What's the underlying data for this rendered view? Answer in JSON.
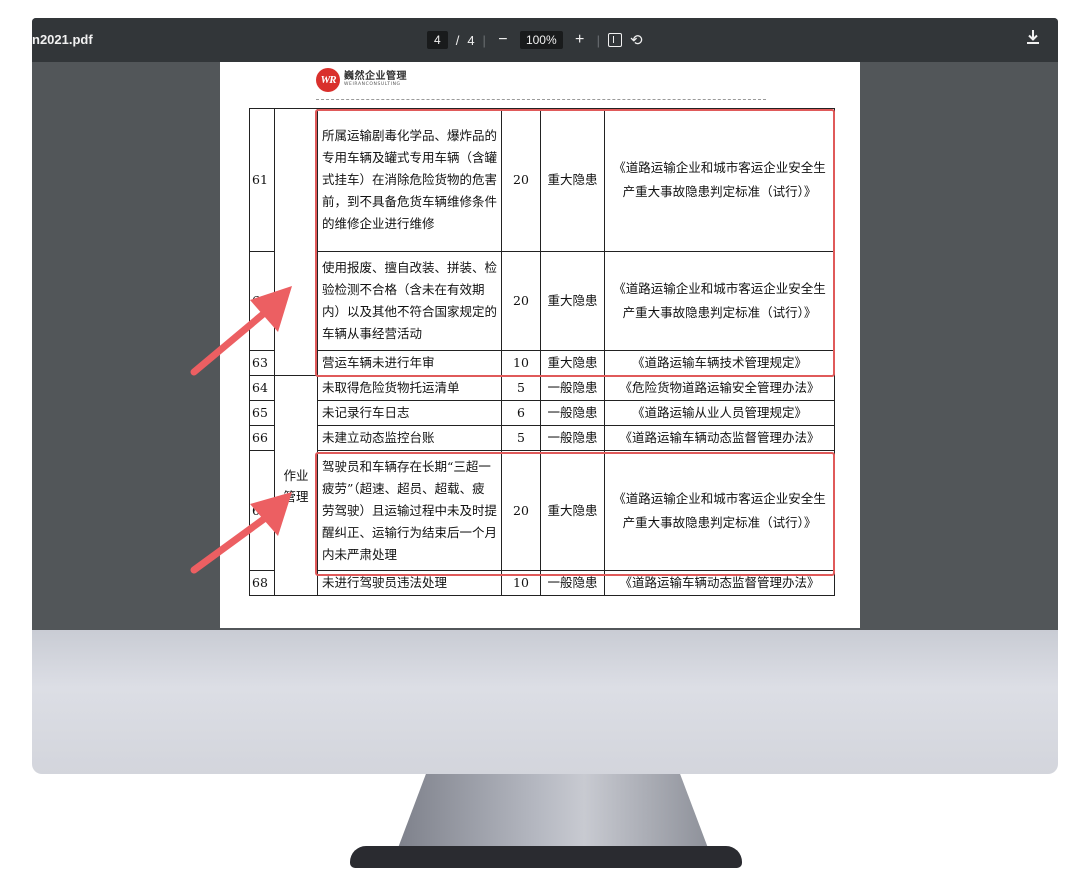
{
  "toolbar": {
    "title": "n2021.pdf",
    "page_current": "4",
    "page_separator": "/",
    "page_total": "4",
    "zoom_out": "−",
    "zoom": "100%",
    "zoom_in": "+",
    "download_icon": "download-icon",
    "rotate_icon": "rotate-icon",
    "fit_icon": "fit-page-icon"
  },
  "logo": {
    "mark": "WR",
    "name_cn": "巍然企业管理",
    "name_en": "WEIRANCONSULTING"
  },
  "table": {
    "category_label": "作业管理",
    "rows": [
      {
        "no": "61",
        "item": "所属运输剧毒化学品、爆炸品的专用车辆及罐式专用车辆（含罐式挂车）在消除危险货物的危害前，到不具备危货车辆维修条件的维修企业进行维修",
        "score": "20",
        "level": "重大隐患",
        "basis": "《道路运输企业和城市客运企业安全生产重大事故隐患判定标准（试行）》"
      },
      {
        "no": "62",
        "item": "使用报废、擅自改装、拼装、检验检测不合格（含未在有效期内）以及其他不符合国家规定的车辆从事经营活动",
        "score": "20",
        "level": "重大隐患",
        "basis": "《道路运输企业和城市客运企业安全生产重大事故隐患判定标准（试行）》"
      },
      {
        "no": "63",
        "item": "营运车辆未进行年审",
        "score": "10",
        "level": "重大隐患",
        "basis": "《道路运输车辆技术管理规定》"
      },
      {
        "no": "64",
        "item": "未取得危险货物托运清单",
        "score": "5",
        "level": "一般隐患",
        "basis": "《危险货物道路运输安全管理办法》"
      },
      {
        "no": "65",
        "item": "未记录行车日志",
        "score": "6",
        "level": "一般隐患",
        "basis": "《道路运输从业人员管理规定》"
      },
      {
        "no": "66",
        "item": "未建立动态监控台账",
        "score": "5",
        "level": "一般隐患",
        "basis": "《道路运输车辆动态监督管理办法》"
      },
      {
        "no": "67",
        "item": "驾驶员和车辆存在长期“三超一疲劳”（超速、超员、超载、疲劳驾驶）且运输过程中未及时提醒纠正、运输行为结束后一个月内未严肃处理",
        "score": "20",
        "level": "重大隐患",
        "basis": "《道路运输企业和城市客运企业安全生产重大事故隐患判定标准（试行）》"
      },
      {
        "no": "68",
        "item": "未进行驾驶员违法处理",
        "score": "10",
        "level": "一般隐患",
        "basis": "《道路运输车辆动态监督管理办法》"
      }
    ]
  },
  "colors": {
    "highlight": "#e05a5a",
    "arrow": "#ec5f62",
    "toolbar": "#323639",
    "viewer_bg": "#525659"
  }
}
